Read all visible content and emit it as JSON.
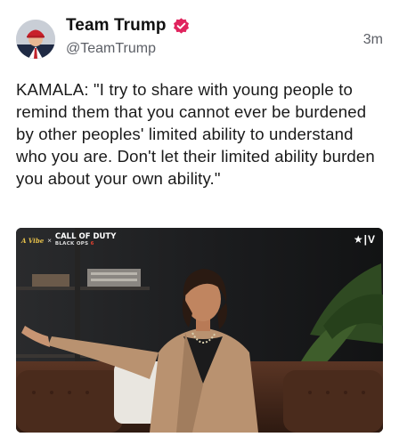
{
  "post": {
    "display_name": "Team Trump",
    "handle": "@TeamTrump",
    "timestamp": "3m",
    "text": "KAMALA: \"I try to share with young people to remind them that you cannot ever be burdened by other peoples' limited ability to understand who you are. Don't let their limited ability burden you about your own ability.\""
  },
  "media": {
    "brand_left": "A Vibe",
    "separator": "×",
    "sponsor_main": "CALL OF DUTY",
    "sponsor_sub_prefix": "BLACK OPS",
    "sponsor_sub_number": "6",
    "corner_mark": "★|V"
  },
  "colors": {
    "verified_badge": "#e0245e",
    "handle_gray": "#5c5f66",
    "jacket": "#b99270",
    "couch": "#4a2b1c"
  },
  "icons": {
    "verified": "verified-badge-icon",
    "avatar": "profile-avatar"
  }
}
